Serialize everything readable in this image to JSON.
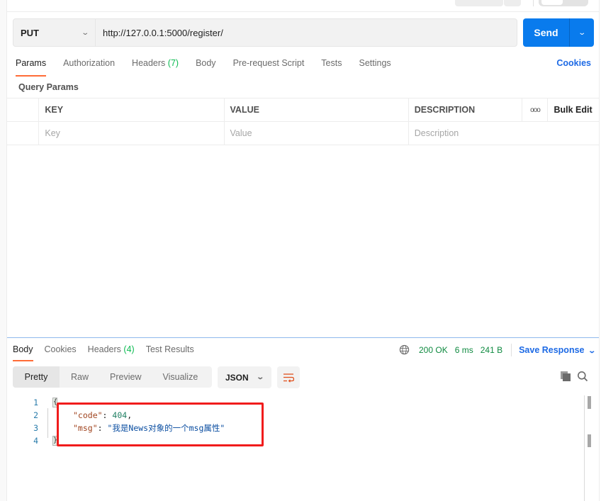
{
  "request": {
    "method": "PUT",
    "url": "http://127.0.0.1:5000/register/",
    "send_label": "Send"
  },
  "request_tabs": [
    {
      "label": "Params",
      "active": true
    },
    {
      "label": "Authorization"
    },
    {
      "label": "Headers",
      "count": "(7)"
    },
    {
      "label": "Body"
    },
    {
      "label": "Pre-request Script"
    },
    {
      "label": "Tests"
    },
    {
      "label": "Settings"
    }
  ],
  "cookies_link": "Cookies",
  "query_params": {
    "title": "Query Params",
    "columns": [
      "KEY",
      "VALUE",
      "DESCRIPTION"
    ],
    "more_icon": "ooo",
    "bulk_edit": "Bulk Edit",
    "placeholders": {
      "key": "Key",
      "value": "Value",
      "description": "Description"
    }
  },
  "response_tabs": [
    {
      "label": "Body",
      "active": true
    },
    {
      "label": "Cookies"
    },
    {
      "label": "Headers",
      "count": "(4)"
    },
    {
      "label": "Test Results"
    }
  ],
  "response_meta": {
    "status": "200 OK",
    "time": "6 ms",
    "size": "241 B",
    "save_label": "Save Response"
  },
  "view_modes": [
    "Pretty",
    "Raw",
    "Preview",
    "Visualize"
  ],
  "format": "JSON",
  "colors": {
    "accent_orange": "#ff6c37",
    "send_blue": "#097bed",
    "link_blue": "#1d6ae5",
    "status_green": "#0f8a40",
    "highlight_red": "#f01c1c"
  },
  "response_body": {
    "line_numbers": [
      "1",
      "2",
      "3",
      "4"
    ],
    "open_brace": "{",
    "close_brace": "}",
    "code_key": "\"code\"",
    "code_value": "404",
    "msg_key": "\"msg\"",
    "msg_value": "\"我是News对象的一个msg属性\"",
    "colon": ": ",
    "comma": ","
  }
}
